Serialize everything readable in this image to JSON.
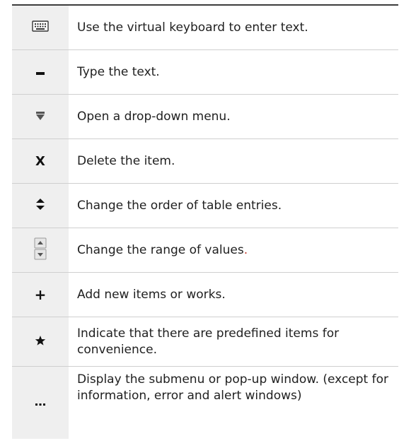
{
  "rows": [
    {
      "icon": "keyboard-icon",
      "text": "Use the virtual keyboard to enter text."
    },
    {
      "icon": "text-cursor-icon",
      "text": "Type the text."
    },
    {
      "icon": "dropdown-arrow-icon",
      "text": "Open a drop-down menu."
    },
    {
      "icon": "delete-x-icon",
      "icon_glyph": "X",
      "text": "Delete the item."
    },
    {
      "icon": "sort-order-icon",
      "text": "Change the order of table entries."
    },
    {
      "icon": "spinner-arrows-icon",
      "text": "Change the range of values",
      "text_suffix": "."
    },
    {
      "icon": "plus-icon",
      "icon_glyph": "+",
      "text": "Add new items or works."
    },
    {
      "icon": "star-icon",
      "text": "Indicate that there are predefined items for convenience."
    },
    {
      "icon": "more-ellipsis-icon",
      "text": "Display the submenu or pop-up window. (except for information, error and alert windows)"
    }
  ]
}
